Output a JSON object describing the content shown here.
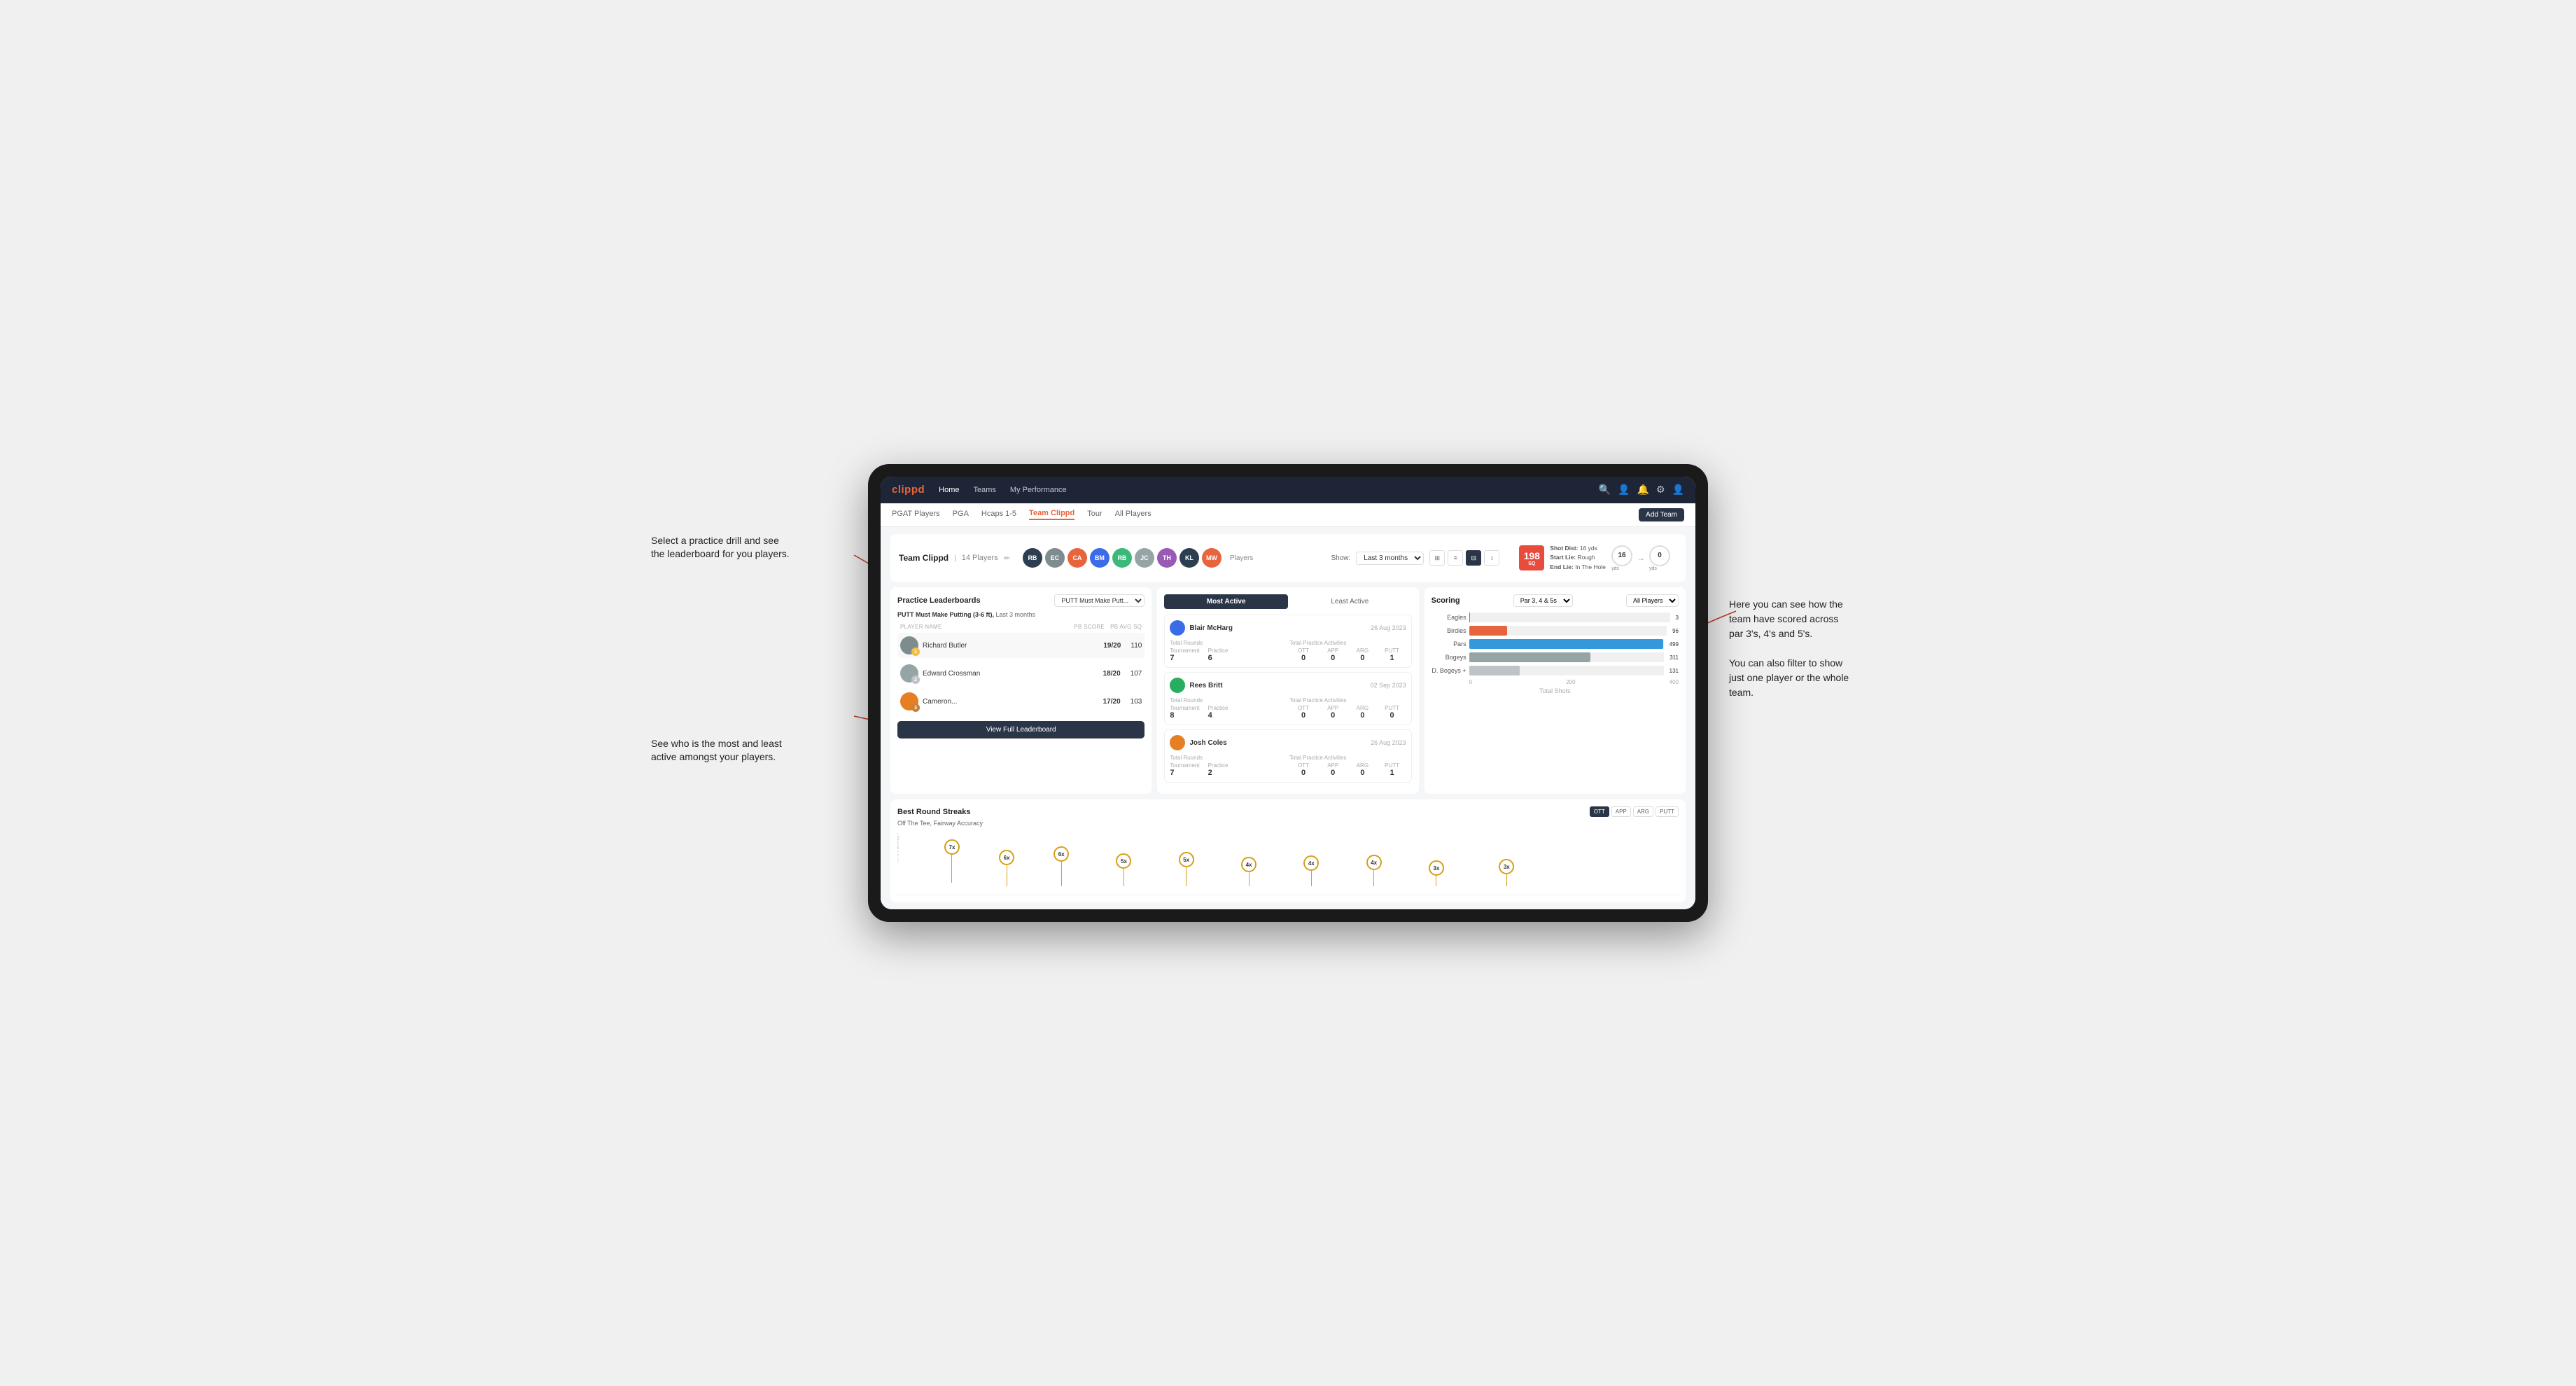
{
  "annotations": {
    "top_left": "Select a practice drill and see\nthe leaderboard for you players.",
    "bottom_left": "See who is the most and least\nactive amongst your players.",
    "right": "Here you can see how the\nteam have scored across\npar 3's, 4's and 5's.\n\nYou can also filter to show\njust one player or the whole\nteam."
  },
  "nav": {
    "logo": "clippd",
    "items": [
      "Home",
      "Teams",
      "My Performance"
    ],
    "active": "Teams",
    "icons": [
      "🔍",
      "👤",
      "🔔",
      "⚙",
      "👤"
    ]
  },
  "subnav": {
    "items": [
      "PGAT Players",
      "PGA",
      "Hcaps 1-5",
      "Team Clippd",
      "Tour",
      "All Players"
    ],
    "active": "Team Clippd",
    "add_button": "Add Team"
  },
  "team_header": {
    "name": "Team Clippd",
    "count": "14 Players",
    "players_label": "Players",
    "show_label": "Show:",
    "show_value": "Last 3 months"
  },
  "shot_info": {
    "number": "198",
    "unit": "SQ",
    "shot_dist_label": "Shot Dist:",
    "shot_dist_val": "16 yds",
    "start_lie_label": "Start Lie:",
    "start_lie_val": "Rough",
    "end_lie_label": "End Lie:",
    "end_lie_val": "In The Hole",
    "yds_left": "16",
    "yds_right": "0"
  },
  "leaderboard": {
    "title": "Practice Leaderboards",
    "select_label": "PUTT Must Make Putt...",
    "subtitle": "PUTT Must Make Putting (3-6 ft),",
    "subtitle_period": "Last 3 months",
    "columns": [
      "PLAYER NAME",
      "PB SCORE",
      "PB AVG SQ"
    ],
    "players": [
      {
        "name": "Richard Butler",
        "score": "19/20",
        "avg": "110",
        "badge": "gold",
        "rank": 1
      },
      {
        "name": "Edward Crossman",
        "score": "18/20",
        "avg": "107",
        "badge": "silver",
        "rank": 2
      },
      {
        "name": "Cameron...",
        "score": "17/20",
        "avg": "103",
        "badge": "bronze",
        "rank": 3
      }
    ],
    "view_full": "View Full Leaderboard"
  },
  "activity": {
    "tabs": [
      "Most Active",
      "Least Active"
    ],
    "active_tab": "Most Active",
    "cards": [
      {
        "name": "Blair McHarg",
        "date": "26 Aug 2023",
        "total_rounds_label": "Total Rounds",
        "tournament": "7",
        "practice": "6",
        "practice_activities_label": "Total Practice Activities",
        "ott": "0",
        "app": "0",
        "arg": "0",
        "putt": "1"
      },
      {
        "name": "Rees Britt",
        "date": "02 Sep 2023",
        "total_rounds_label": "Total Rounds",
        "tournament": "8",
        "practice": "4",
        "practice_activities_label": "Total Practice Activities",
        "ott": "0",
        "app": "0",
        "arg": "0",
        "putt": "0"
      },
      {
        "name": "Josh Coles",
        "date": "26 Aug 2023",
        "total_rounds_label": "Total Rounds",
        "tournament": "7",
        "practice": "2",
        "practice_activities_label": "Total Practice Activities",
        "ott": "0",
        "app": "0",
        "arg": "0",
        "putt": "1"
      }
    ]
  },
  "scoring": {
    "title": "Scoring",
    "filter1": "Par 3, 4 & 5s",
    "filter2": "All Players",
    "bars": [
      {
        "label": "Eagles",
        "value": 3,
        "max": 500,
        "color": "#27ae60"
      },
      {
        "label": "Birdies",
        "value": 96,
        "max": 500,
        "color": "#e8643c"
      },
      {
        "label": "Pars",
        "value": 499,
        "max": 500,
        "color": "#3498db"
      },
      {
        "label": "Bogeys",
        "value": 311,
        "max": 500,
        "color": "#95a5a6"
      },
      {
        "label": "D. Bogeys +",
        "value": 131,
        "max": 500,
        "color": "#bdc3c7"
      }
    ],
    "axis_labels": [
      "0",
      "200",
      "400"
    ],
    "x_axis_label": "Total Shots"
  },
  "streaks": {
    "title": "Best Round Streaks",
    "subtitle": "Off The Tee, Fairway Accuracy",
    "buttons": [
      "OTT",
      "APP",
      "ARG",
      "PUTT"
    ],
    "active_btn": "OTT",
    "nodes": [
      {
        "x": 5,
        "label": "7x"
      },
      {
        "x": 11,
        "label": "6x"
      },
      {
        "x": 18,
        "label": "6x"
      },
      {
        "x": 26,
        "label": "5x"
      },
      {
        "x": 33,
        "label": "5x"
      },
      {
        "x": 41,
        "label": "4x"
      },
      {
        "x": 49,
        "label": "4x"
      },
      {
        "x": 57,
        "label": "4x"
      },
      {
        "x": 65,
        "label": "3x"
      },
      {
        "x": 73,
        "label": "3x"
      }
    ]
  }
}
